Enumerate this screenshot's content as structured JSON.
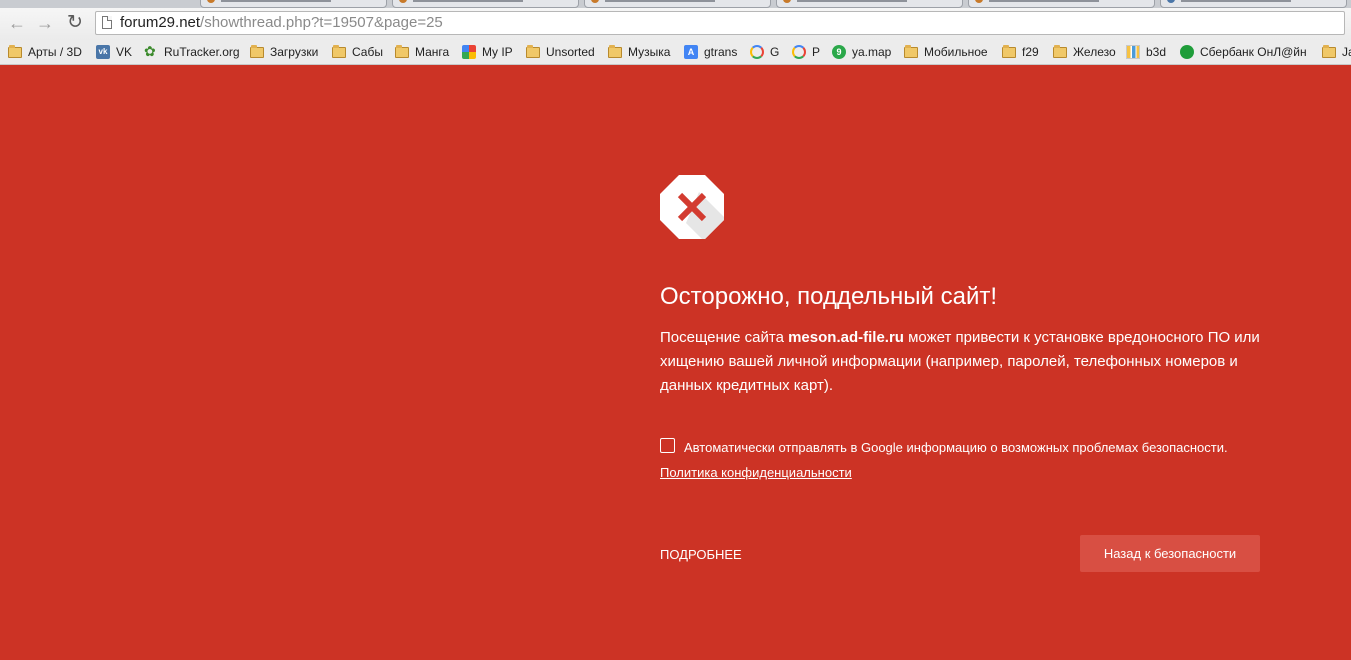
{
  "browser": {
    "url_host": "forum29.net",
    "url_path": "/showthread.php?t=19507&page=25",
    "bookmarks": [
      {
        "label": "Арты / 3D",
        "icon": "folder-icon"
      },
      {
        "label": "VK",
        "icon": "vk-icon"
      },
      {
        "label": "RuTracker.org",
        "icon": "rutracker-icon"
      },
      {
        "label": "Загрузки",
        "icon": "folder-icon"
      },
      {
        "label": "Сабы",
        "icon": "folder-icon"
      },
      {
        "label": "Манга",
        "icon": "folder-icon"
      },
      {
        "label": "My IP",
        "icon": "myip-icon"
      },
      {
        "label": "Unsorted",
        "icon": "folder-icon"
      },
      {
        "label": "Музыка",
        "icon": "folder-icon"
      },
      {
        "label": "gtrans",
        "icon": "gtrans-icon"
      },
      {
        "label": "G",
        "icon": "google-icon"
      },
      {
        "label": "P",
        "icon": "google-icon"
      },
      {
        "label": "ya.map",
        "icon": "yamap-icon"
      },
      {
        "label": "Мобильное",
        "icon": "folder-icon"
      },
      {
        "label": "f29",
        "icon": "folder-icon"
      },
      {
        "label": "Железо",
        "icon": "folder-icon"
      },
      {
        "label": "b3d",
        "icon": "b3d-icon"
      },
      {
        "label": "Сбербанк ОнЛ@йн",
        "icon": "sberbank-icon"
      },
      {
        "label": "Ja",
        "icon": "folder-icon"
      }
    ]
  },
  "interstitial": {
    "title": "Осторожно, поддельный сайт!",
    "desc_before": "Посещение сайта ",
    "desc_site": "meson.ad-file.ru",
    "desc_after": " может привести к установке вредоносного ПО или хищению вашей личной информации (например, паролей, телефонных номеров и данных кредитных карт).",
    "checkbox_label": "Автоматически отправлять в Google информацию о возможных проблемах безопасности.",
    "checkbox_checked": false,
    "privacy_link": "Политика конфиденциальности",
    "details_link": "ПОДРОБНЕЕ",
    "back_button": "Назад к безопасности"
  },
  "colors": {
    "page_background": "#cc3325",
    "button_background": "#d84f43",
    "icon_cross": "#d33b30"
  }
}
